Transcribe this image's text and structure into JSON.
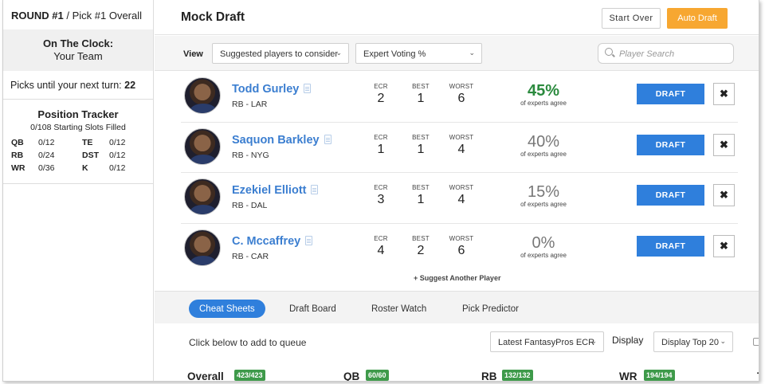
{
  "sidebar": {
    "round_bold": "ROUND #1",
    "round_rest": " / Pick #1 Overall",
    "clock_title": "On The Clock:",
    "clock_team": "Your Team",
    "picks_label": "Picks until your next turn: ",
    "picks_value": "22",
    "tracker_title": "Position Tracker",
    "tracker_sub": "0/108 Starting Slots Filled",
    "positions": [
      {
        "pos": "QB",
        "val": "0/12"
      },
      {
        "pos": "TE",
        "val": "0/12"
      },
      {
        "pos": "RB",
        "val": "0/24"
      },
      {
        "pos": "DST",
        "val": "0/12"
      },
      {
        "pos": "WR",
        "val": "0/36"
      },
      {
        "pos": "K",
        "val": "0/12"
      }
    ]
  },
  "header": {
    "title": "Mock Draft",
    "start_over": "Start Over",
    "auto_draft": "Auto Draft"
  },
  "viewbar": {
    "label": "View",
    "select1": "Suggested players to consider",
    "select2": "Expert Voting %",
    "search_placeholder": "Player Search"
  },
  "stat_labels": {
    "ecr": "ECR",
    "best": "BEST",
    "worst": "WORST",
    "agree": "of experts agree",
    "draft": "DRAFT"
  },
  "players": [
    {
      "name": "Todd Gurley",
      "team": "RB - LAR",
      "ecr": "2",
      "best": "1",
      "worst": "6",
      "pct": "45%"
    },
    {
      "name": "Saquon Barkley",
      "team": "RB - NYG",
      "ecr": "1",
      "best": "1",
      "worst": "4",
      "pct": "40%"
    },
    {
      "name": "Ezekiel Elliott",
      "team": "RB - DAL",
      "ecr": "3",
      "best": "1",
      "worst": "4",
      "pct": "15%"
    },
    {
      "name": "C. Mccaffrey",
      "team": "RB - CAR",
      "ecr": "4",
      "best": "2",
      "worst": "6",
      "pct": "0%"
    }
  ],
  "suggest": "+ Suggest Another Player",
  "tabs": [
    "Cheat Sheets",
    "Draft Board",
    "Roster Watch",
    "Pick Predictor"
  ],
  "queue": {
    "label": "Click below to add to queue",
    "ecr_select": "Latest FantasyPros ECR",
    "display_label": "Display",
    "display_select": "Display Top 20"
  },
  "position_tabs": [
    {
      "label": "Overall",
      "count": "423/423"
    },
    {
      "label": "QB",
      "count": "60/60"
    },
    {
      "label": "RB",
      "count": "132/132"
    },
    {
      "label": "WR",
      "count": "194/194"
    },
    {
      "label": "T",
      "count": ""
    }
  ],
  "colors": {
    "accent": "#2f7fdc",
    "auto_draft": "#f7a731",
    "agree_top": "#2b8a3e",
    "badge": "#3e9a4a"
  }
}
